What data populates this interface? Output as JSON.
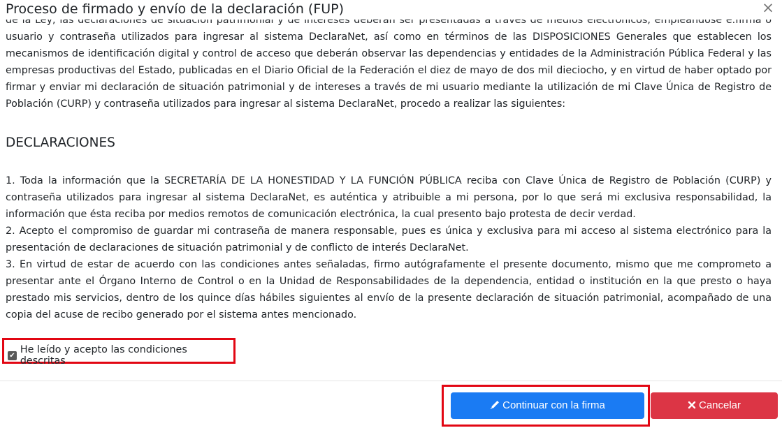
{
  "modal": {
    "title": "Proceso de firmado y envío de la declaración (FUP)",
    "close_icon": "×"
  },
  "body": {
    "intro": "de la Ley, las declaraciones de situación patrimonial y de intereses deberán ser presentadas a través de medios electrónicos, empleándose e.firma o usuario y contraseña utilizados para ingresar al sistema DeclaraNet, así como en términos de las DISPOSICIONES Generales que establecen los mecanismos de identificación digital y control de acceso que deberán observar las dependencias y entidades de la Administración Pública Federal y las empresas productivas del Estado, publicadas en el Diario Oficial de la Federación el diez de mayo de dos mil dieciocho, y en virtud de haber optado por firmar y enviar mi declaración de situación patrimonial y de intereses a través de mi usuario mediante la utilización de mi Clave Única de Registro de Población (CURP) y contraseña utilizados para ingresar al sistema DeclaraNet, procedo a realizar las siguientes:",
    "section_title": "DECLARACIONES",
    "items": [
      "1. Toda la información que la SECRETARÍA DE LA HONESTIDAD Y LA FUNCIÓN PÚBLICA reciba con Clave Única de Registro de Población (CURP) y contraseña utilizados para ingresar al sistema DeclaraNet, es auténtica y atribuible a mi persona, por lo que será mi exclusiva responsabilidad, la información que ésta reciba por medios remotos de comunicación electrónica, la cual presento bajo protesta de decir verdad.",
      "2. Acepto el compromiso de guardar mi contraseña de manera responsable, pues es única y exclusiva para mi acceso al sistema electrónico para la presentación de declaraciones de situación patrimonial y de conflicto de interés DeclaraNet.",
      "3. En virtud de estar de acuerdo con las condiciones antes señaladas, firmo autógrafamente el presente documento, mismo que me comprometo a presentar ante el Órgano Interno de Control o en la Unidad de Responsabilidades de la dependencia, entidad o institución en la que presto o haya prestado mis servicios, dentro de los quince días hábiles siguientes al envío de la presente declaración de situación patrimonial, acompañado de una copia del acuse de recibo generado por el sistema antes mencionado."
    ],
    "accept_label": "He leído y acepto las condiciones descritas",
    "accept_checked": true
  },
  "footer": {
    "continue_label": "Continuar con la firma",
    "cancel_label": "Cancelar",
    "continue_icon": "pencil-icon",
    "cancel_icon": "times-icon"
  },
  "colors": {
    "primary": "#1a7bf3",
    "danger": "#dc3545",
    "highlight": "#e20613"
  }
}
